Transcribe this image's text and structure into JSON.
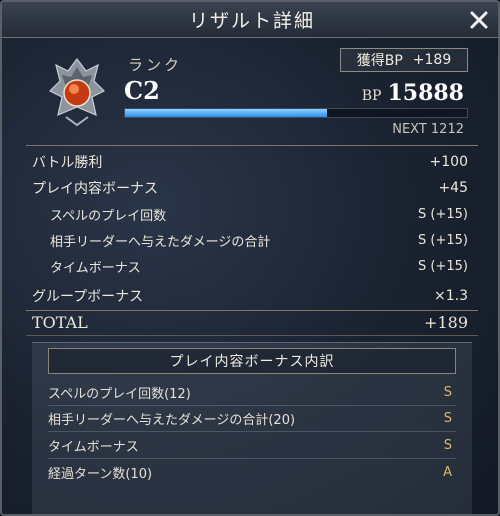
{
  "title": "リザルト詳細",
  "rank": {
    "label": "ランク",
    "value": "C2",
    "earned_label": "獲得BP",
    "earned_value": "+189",
    "bp_label": "BP",
    "bp_value": "15888",
    "progress_fraction": 0.59,
    "next_text": "NEXT 1212"
  },
  "results": [
    {
      "label": "バトル勝利",
      "value": "+100",
      "sub": false
    },
    {
      "label": "プレイ内容ボーナス",
      "value": "+45",
      "sub": false
    },
    {
      "label": "スペルのプレイ回数",
      "value": "S (+15)",
      "sub": true
    },
    {
      "label": "相手リーダーへ与えたダメージの合計",
      "value": "S (+15)",
      "sub": true
    },
    {
      "label": "タイムボーナス",
      "value": "S (+15)",
      "sub": true
    },
    {
      "label": "グループボーナス",
      "value": "×1.3",
      "sub": false
    }
  ],
  "total": {
    "label": "TOTAL",
    "value": "+189"
  },
  "breakdown": {
    "title": "プレイ内容ボーナス内訳",
    "items": [
      {
        "label": "スペルのプレイ回数(12)",
        "grade": "S"
      },
      {
        "label": "相手リーダーへ与えたダメージの合計(20)",
        "grade": "S"
      },
      {
        "label": "タイムボーナス",
        "grade": "S"
      },
      {
        "label": "経過ターン数(10)",
        "grade": "A"
      }
    ]
  },
  "icons": {
    "close": "close-icon",
    "emblem": "rank-emblem-icon"
  },
  "colors": {
    "accent_gold": "#d9b86e",
    "progress": "#2a8ff0"
  }
}
